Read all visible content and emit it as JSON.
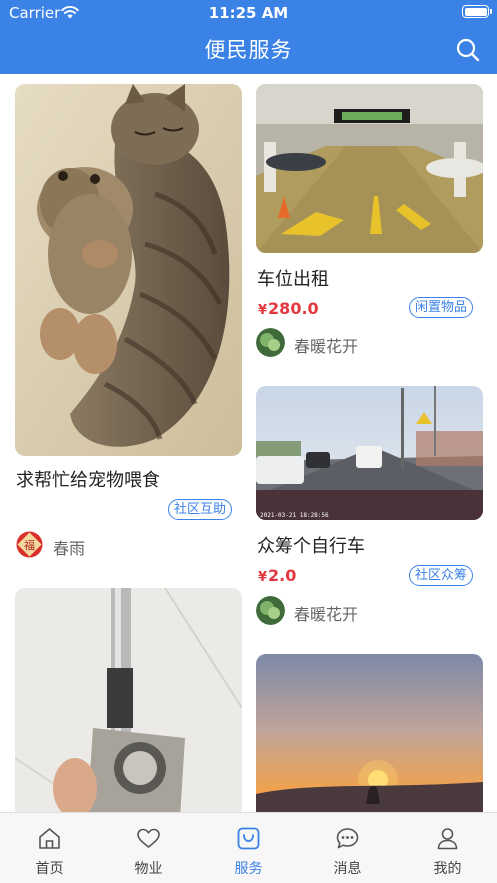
{
  "status_bar": {
    "carrier": "Carrier",
    "time": "11:25 AM"
  },
  "header": {
    "title": "便民服务",
    "search_icon": "search-icon"
  },
  "colors": {
    "brand": "#3b82e6",
    "price": "#e2383f",
    "tab_active": "#3b82e6"
  },
  "posts": [
    {
      "title": "求帮忙给宠物喂食",
      "tag": "社区互助",
      "author": "春雨",
      "image": "kitten-hugging-plush-toy"
    },
    {
      "title": "车位出租",
      "price_currency": "¥",
      "price_value": "280.0",
      "tag": "闲置物品",
      "author": "春暖花开",
      "image": "underground-parking-garage"
    },
    {
      "title": "众筹个自行车",
      "price_currency": "¥",
      "price_value": "2.0",
      "tag": "社区众筹",
      "author": "春暖花开",
      "image": "road-from-car-dashcam",
      "image_timestamp": "2021-03-21 18:28:56"
    },
    {
      "title": "",
      "image": "handheld-vacuum-on-marble"
    },
    {
      "title": "",
      "image": "sunset-over-hills"
    }
  ],
  "tab_bar": {
    "active": "服务",
    "tabs": [
      {
        "label": "首页",
        "icon": "home-icon"
      },
      {
        "label": "物业",
        "icon": "heart-icon"
      },
      {
        "label": "服务",
        "icon": "service-bag-icon"
      },
      {
        "label": "消息",
        "icon": "message-bubble-icon"
      },
      {
        "label": "我的",
        "icon": "person-icon"
      }
    ]
  }
}
